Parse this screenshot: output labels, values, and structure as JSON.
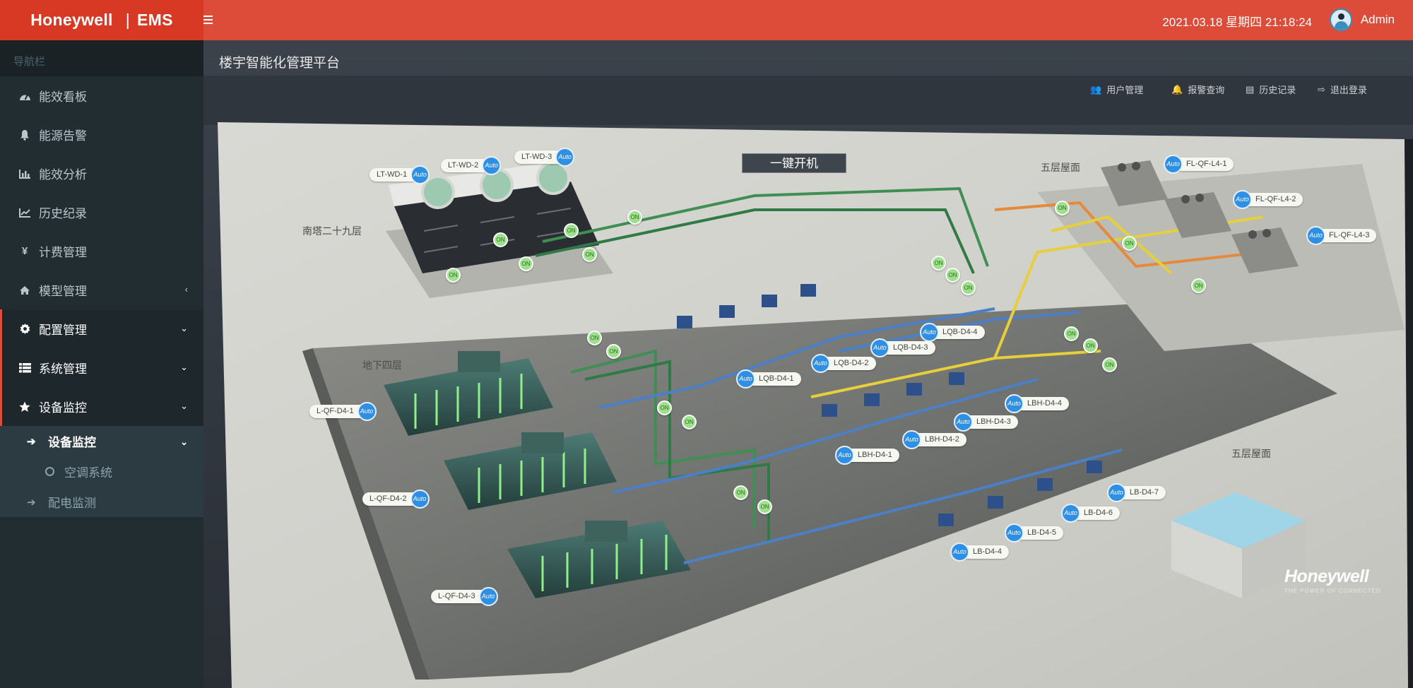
{
  "brand": {
    "name": "Honeywell",
    "product": "EMS"
  },
  "header": {
    "datetime": "2021.03.18 星期四 21:18:24",
    "user": "Admin"
  },
  "sidebar": {
    "header": "导航栏",
    "items": [
      {
        "label": "能效看板",
        "icon": "dashboard-icon"
      },
      {
        "label": "能源告警",
        "icon": "bell-icon"
      },
      {
        "label": "能效分析",
        "icon": "bar-chart-icon"
      },
      {
        "label": "历史纪录",
        "icon": "line-chart-icon"
      },
      {
        "label": "计费管理",
        "icon": "yen-icon"
      },
      {
        "label": "模型管理",
        "icon": "home-icon"
      },
      {
        "label": "配置管理",
        "icon": "gear-icon"
      },
      {
        "label": "系统管理",
        "icon": "table-icon"
      },
      {
        "label": "设备监控",
        "icon": "star-icon"
      }
    ],
    "sub": {
      "label": "设备监控",
      "child": "空调系统",
      "sibling": "配电监测"
    }
  },
  "scene": {
    "title": "楼宇智能化管理平台",
    "nav": [
      "用户管理",
      "报警查询",
      "历史记录",
      "退出登录"
    ],
    "onekey": "一键开机",
    "areas": [
      "南塔二十九层",
      "地下四层",
      "五层屋面",
      "五层屋面"
    ],
    "tag_auto": "Auto",
    "tag_on": "ON",
    "tags": {
      "cooling_towers": [
        "LT-WD-1",
        "LT-WD-2",
        "LT-WD-3"
      ],
      "chillers": [
        "L-QF-D4-1",
        "L-QF-D4-2",
        "L-QF-D4-3"
      ],
      "rooftop": [
        "FL-QF-L4-1",
        "FL-QF-L4-2",
        "FL-QF-L4-3"
      ],
      "lqb": [
        "LQB-D4-1",
        "LQB-D4-2",
        "LQB-D4-3",
        "LQB-D4-4"
      ],
      "lbh": [
        "LBH-D4-1",
        "LBH-D4-2",
        "LBH-D4-3",
        "LBH-D4-4"
      ],
      "lb": [
        "LB-D4-4",
        "LB-D4-5",
        "LB-D4-6",
        "LB-D4-7"
      ]
    },
    "watermark": "Honeywell",
    "watermark_sub": "THE POWER OF CONNECTED"
  }
}
